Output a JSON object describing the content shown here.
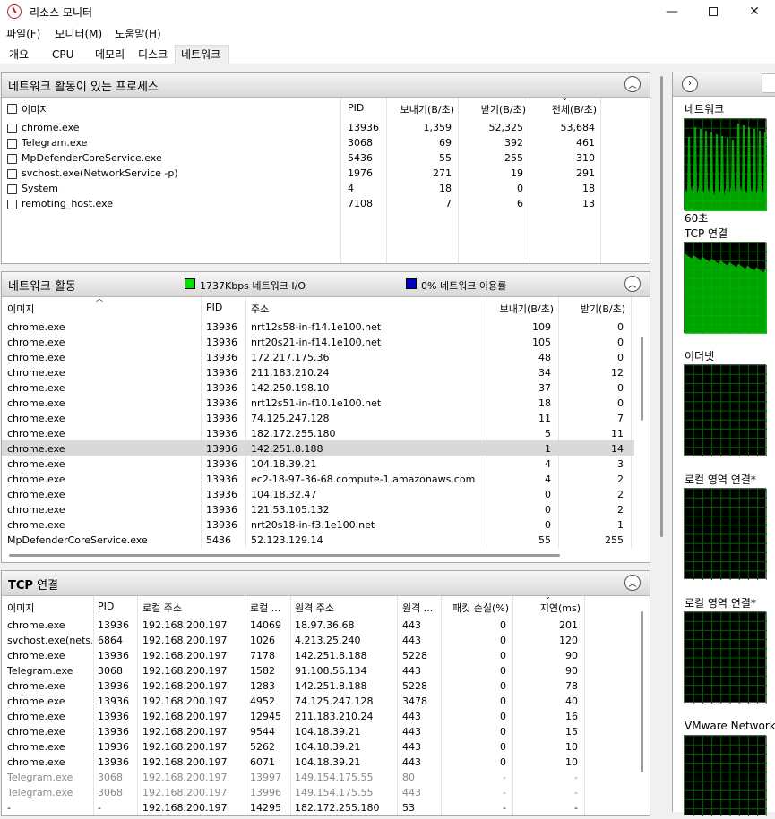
{
  "window": {
    "title": "리소스 모니터"
  },
  "menu": [
    "파일(F)",
    "모니터(M)",
    "도움말(H)"
  ],
  "tabs": [
    "개요",
    "CPU",
    "메모리",
    "디스크",
    "네트워크"
  ],
  "procs": {
    "title": "네트워크 활동이 있는 프로세스",
    "headers": [
      "이미지",
      "PID",
      "보내기(B/초)",
      "받기(B/초)",
      "전체(B/초)"
    ],
    "rows": [
      [
        "chrome.exe",
        "13936",
        "1,359",
        "52,325",
        "53,684"
      ],
      [
        "Telegram.exe",
        "3068",
        "69",
        "392",
        "461"
      ],
      [
        "MpDefenderCoreService.exe",
        "5436",
        "55",
        "255",
        "310"
      ],
      [
        "svchost.exe(NetworkService -p)",
        "1976",
        "271",
        "19",
        "291"
      ],
      [
        "System",
        "4",
        "18",
        "0",
        "18"
      ],
      [
        "remoting_host.exe",
        "7108",
        "7",
        "6",
        "13"
      ]
    ]
  },
  "activity": {
    "title": "네트워크 활동",
    "io_label": "1737Kbps 네트워크 I/O",
    "util_label": "0% 네트워크 이용률",
    "io_color": "#00e000",
    "util_color": "#0000c0",
    "headers": [
      "이미지",
      "PID",
      "주소",
      "보내기(B/초)",
      "받기(B/초)"
    ],
    "rows": [
      [
        "chrome.exe",
        "13936",
        "nrt12s58-in-f14.1e100.net",
        "109",
        "0"
      ],
      [
        "chrome.exe",
        "13936",
        "nrt20s21-in-f14.1e100.net",
        "105",
        "0"
      ],
      [
        "chrome.exe",
        "13936",
        "172.217.175.36",
        "48",
        "0"
      ],
      [
        "chrome.exe",
        "13936",
        "211.183.210.24",
        "34",
        "12"
      ],
      [
        "chrome.exe",
        "13936",
        "142.250.198.10",
        "37",
        "0"
      ],
      [
        "chrome.exe",
        "13936",
        "nrt12s51-in-f10.1e100.net",
        "18",
        "0"
      ],
      [
        "chrome.exe",
        "13936",
        "74.125.247.128",
        "11",
        "7"
      ],
      [
        "chrome.exe",
        "13936",
        "182.172.255.180",
        "5",
        "11"
      ],
      [
        "chrome.exe",
        "13936",
        "142.251.8.188",
        "1",
        "14"
      ],
      [
        "chrome.exe",
        "13936",
        "104.18.39.21",
        "4",
        "3"
      ],
      [
        "chrome.exe",
        "13936",
        "ec2-18-97-36-68.compute-1.amazonaws.com",
        "4",
        "2"
      ],
      [
        "chrome.exe",
        "13936",
        "104.18.32.47",
        "0",
        "2"
      ],
      [
        "chrome.exe",
        "13936",
        "121.53.105.132",
        "0",
        "2"
      ],
      [
        "chrome.exe",
        "13936",
        "nrt20s18-in-f3.1e100.net",
        "0",
        "1"
      ],
      [
        "MpDefenderCoreService.exe",
        "5436",
        "52.123.129.14",
        "55",
        "255"
      ]
    ]
  },
  "tcp": {
    "title_bold": "TCP",
    "title_rest": "연결",
    "headers": [
      "이미지",
      "PID",
      "로컬 주소",
      "로컬 ...",
      "원격 주소",
      "원격 ...",
      "패킷 손실(%)",
      "지연(ms)"
    ],
    "rows": [
      [
        "chrome.exe",
        "13936",
        "192.168.200.197",
        "14069",
        "18.97.36.68",
        "443",
        "0",
        "201"
      ],
      [
        "svchost.exe(nets...",
        "6864",
        "192.168.200.197",
        "1026",
        "4.213.25.240",
        "443",
        "0",
        "120"
      ],
      [
        "chrome.exe",
        "13936",
        "192.168.200.197",
        "7178",
        "142.251.8.188",
        "5228",
        "0",
        "90"
      ],
      [
        "Telegram.exe",
        "3068",
        "192.168.200.197",
        "1582",
        "91.108.56.134",
        "443",
        "0",
        "90"
      ],
      [
        "chrome.exe",
        "13936",
        "192.168.200.197",
        "1283",
        "142.251.8.188",
        "5228",
        "0",
        "78"
      ],
      [
        "chrome.exe",
        "13936",
        "192.168.200.197",
        "4952",
        "74.125.247.128",
        "3478",
        "0",
        "40"
      ],
      [
        "chrome.exe",
        "13936",
        "192.168.200.197",
        "12945",
        "211.183.210.24",
        "443",
        "0",
        "16"
      ],
      [
        "chrome.exe",
        "13936",
        "192.168.200.197",
        "9544",
        "104.18.39.21",
        "443",
        "0",
        "15"
      ],
      [
        "chrome.exe",
        "13936",
        "192.168.200.197",
        "5262",
        "104.18.39.21",
        "443",
        "0",
        "10"
      ],
      [
        "chrome.exe",
        "13936",
        "192.168.200.197",
        "6071",
        "104.18.39.21",
        "443",
        "0",
        "10"
      ],
      [
        "Telegram.exe",
        "3068",
        "192.168.200.197",
        "13997",
        "149.154.175.55",
        "80",
        "-",
        "-"
      ],
      [
        "Telegram.exe",
        "3068",
        "192.168.200.197",
        "13996",
        "149.154.175.55",
        "443",
        "-",
        "-"
      ],
      [
        "-",
        "-",
        "192.168.200.197",
        "14295",
        "182.172.255.180",
        "53",
        "-",
        "-"
      ]
    ]
  },
  "side": {
    "labels": [
      "네트워크",
      "60초",
      "TCP 연결",
      "이더넷",
      "로컬 영역 연결*",
      "로컬 영역 연결*",
      "VMware Network"
    ],
    "graph_color": "#00c000",
    "grid_color": "#006000"
  }
}
